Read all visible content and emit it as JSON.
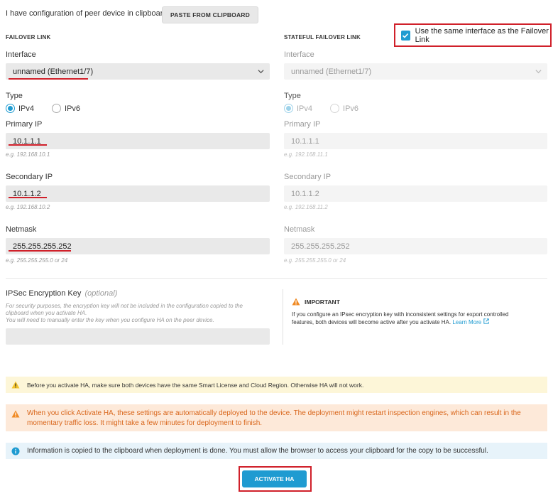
{
  "header": {
    "clipboard_text": "I have configuration of peer device in clipboard",
    "paste_button": "PASTE FROM CLIPBOARD"
  },
  "failover": {
    "title": "FAILOVER LINK",
    "interface_label": "Interface",
    "interface_value": "unnamed (Ethernet1/7)",
    "type_label": "Type",
    "ipv4": "IPv4",
    "ipv6": "IPv6",
    "selected_type": "IPv4",
    "primary_label": "Primary IP",
    "primary_value": "10.1.1.1",
    "primary_hint": "e.g. 192.168.10.1",
    "secondary_label": "Secondary IP",
    "secondary_value": "10.1.1.2",
    "secondary_hint": "e.g. 192.168.10.2",
    "netmask_label": "Netmask",
    "netmask_value": "255.255.255.252",
    "netmask_hint": "e.g. 255.255.255.0 or 24"
  },
  "stateful": {
    "title": "STATEFUL FAILOVER LINK",
    "same_interface_label": "Use the same interface as the Failover Link",
    "same_interface_checked": true,
    "interface_label": "Interface",
    "interface_value": "unnamed (Ethernet1/7)",
    "type_label": "Type",
    "ipv4": "IPv4",
    "ipv6": "IPv6",
    "selected_type": "IPv4",
    "primary_label": "Primary IP",
    "primary_value": "10.1.1.1",
    "primary_hint": "e.g. 192.168.11.1",
    "secondary_label": "Secondary IP",
    "secondary_value": "10.1.1.2",
    "secondary_hint": "e.g. 192.168.11.2",
    "netmask_label": "Netmask",
    "netmask_value": "255.255.255.252",
    "netmask_hint": "e.g. 255.255.255.0 or 24"
  },
  "ipsec": {
    "label": "IPSec Encryption Key",
    "optional": "(optional)",
    "desc_line1": "For security purposes, the encryption key will not be included in the configuration copied to the",
    "desc_line2": "clipboard when you activate HA.",
    "desc_line3": "You will need to manually enter the key when you configure HA on the peer device.",
    "value": ""
  },
  "important": {
    "title": "IMPORTANT",
    "line1": "If you configure an IPsec encryption key with inconsistent settings for export controlled",
    "line2": "features, both devices will become active after you activate HA.",
    "learn_more": "Learn More"
  },
  "banners": {
    "yellow": "Before you activate HA, make sure both devices have the same Smart License and Cloud Region. Otherwise HA will not work.",
    "orange_line1": "When you click Activate HA, these settings are automatically deployed to the device. The deployment might restart inspection engines, which can result in the",
    "orange_line2": "momentary traffic loss. It might take a few minutes for deployment to finish.",
    "blue": "Information is copied to the clipboard when deployment is done. You must allow the browser to access your clipboard for the copy to be successful."
  },
  "activate_button": "ACTIVATE HA",
  "colors": {
    "accent": "#1f9bd1",
    "highlight_red": "#d0202a",
    "warning_orange": "#f08a24",
    "warning_yellow": "#f3c32d"
  }
}
